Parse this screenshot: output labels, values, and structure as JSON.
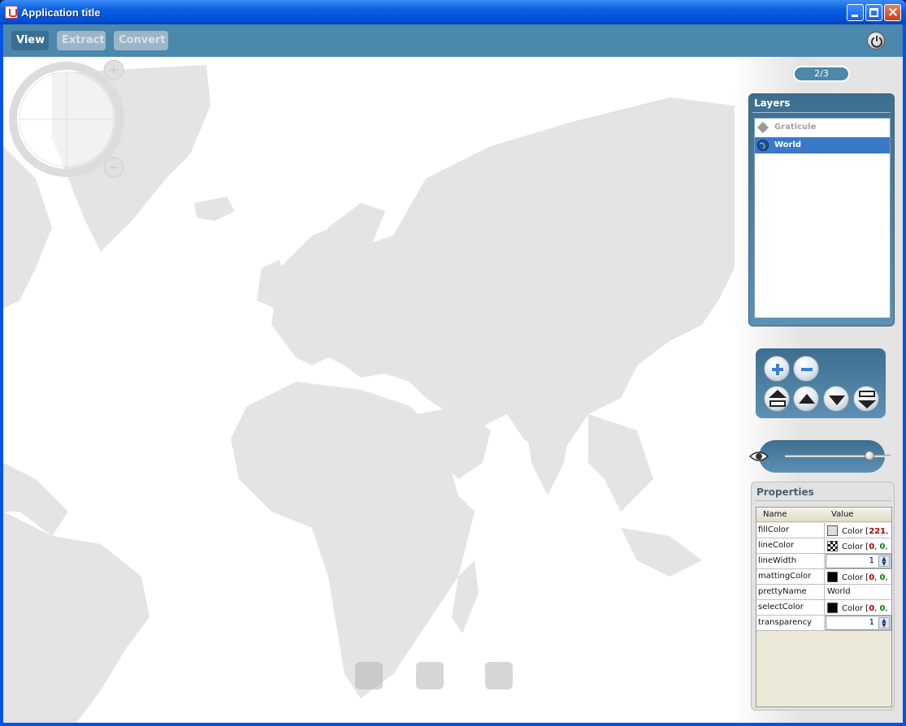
{
  "window": {
    "title": "Application title"
  },
  "toolbar": {
    "view_label": "View",
    "extract_label": "Extract",
    "convert_label": "Convert",
    "power_icon": "power-icon"
  },
  "pager": {
    "text": "2/3"
  },
  "layers": {
    "title": "Layers",
    "items": [
      {
        "label": "Graticule",
        "icon": "graticule-icon",
        "selected": false
      },
      {
        "label": "World",
        "icon": "globe-icon",
        "selected": true
      }
    ]
  },
  "layer_controls": [
    "add-layer-button",
    "remove-layer-button",
    "move-top-button",
    "move-up-button",
    "move-down-button",
    "move-bottom-button"
  ],
  "opacity_slider": {
    "value": 0.8
  },
  "properties": {
    "title": "Properties",
    "columns": [
      "Name",
      "Value"
    ],
    "rows": [
      {
        "name": "fillColor",
        "swatch": "#dddddd",
        "prefix": "Color [",
        "r": "221",
        "g": "",
        "suffix": ","
      },
      {
        "name": "lineColor",
        "swatch": "checker",
        "prefix": "Color [",
        "r": "0",
        "g": "0",
        "suffix": ","
      },
      {
        "name": "lineWidth",
        "spinner": "1"
      },
      {
        "name": "mattingColor",
        "swatch": "#000000",
        "prefix": "Color [",
        "r": "0",
        "g": "0",
        "suffix": ","
      },
      {
        "name": "prettyName",
        "text": "World"
      },
      {
        "name": "selectColor",
        "swatch": "#000000",
        "prefix": "Color [",
        "r": "0",
        "g": "0",
        "suffix": ","
      },
      {
        "name": "transparency",
        "spinner": "1"
      }
    ]
  },
  "colors": {
    "toolbar": "#4c87ac",
    "land": "#e4e4e4",
    "panel": "#3e6e8f"
  }
}
